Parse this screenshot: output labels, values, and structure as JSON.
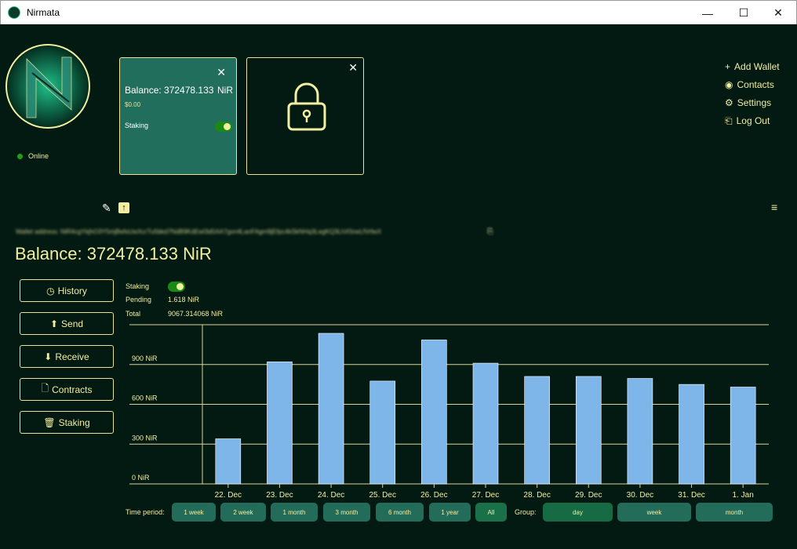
{
  "window": {
    "title": "Nirmata",
    "minimize": "—",
    "maximize": "☐",
    "close": "✕"
  },
  "status": {
    "label": "Online",
    "color": "#1ea01a"
  },
  "wallet_card": {
    "balance": "Balance: 372478.133",
    "unit": "NiR",
    "fiat": "$0.00",
    "staking_label": "Staking",
    "staking_on": true
  },
  "locked_card": {
    "icon": "lock-icon"
  },
  "menu": [
    {
      "icon": "plus-icon",
      "label": "Add Wallet"
    },
    {
      "icon": "user-circle-icon",
      "label": "Contacts"
    },
    {
      "icon": "gear-icon",
      "label": "Settings"
    },
    {
      "icon": "logout-icon",
      "label": "Log Out"
    }
  ],
  "wallet_address": {
    "label": "Wallet address:",
    "value": "NiR4cgYkjhO3Y5mjBefsUwXcrTu5bkd7NdB9KdEwl3d5AA7gvn4LanFAgm9jEfpc4kSkNHq3LegKQ3LhX5neLfVrfwX"
  },
  "balance": "Balance: 372478.133 NiR",
  "side_buttons": [
    {
      "icon": "clock-icon",
      "label": "History"
    },
    {
      "icon": "upload-icon",
      "label": "Send"
    },
    {
      "icon": "download-icon",
      "label": "Receive"
    },
    {
      "icon": "document-icon",
      "label": "Contracts"
    },
    {
      "icon": "bucket-icon",
      "label": "Staking"
    }
  ],
  "staking_info": {
    "staking_label": "Staking",
    "staking_on": true,
    "pending_label": "Pending",
    "pending_value": "1.618 NiR",
    "total_label": "Total",
    "total_value": "9067.314068 NiR"
  },
  "chart_data": {
    "type": "bar",
    "categories": [
      "22. Dec",
      "23. Dec",
      "24. Dec",
      "25. Dec",
      "26. Dec",
      "27. Dec",
      "28. Dec",
      "29. Dec",
      "30. Dec",
      "31. Dec",
      "1. Jan"
    ],
    "values": [
      340,
      920,
      1135,
      775,
      1085,
      910,
      810,
      810,
      795,
      750,
      730
    ],
    "yticks": [
      "0 NiR",
      "300 NiR",
      "600 NiR",
      "900 NiR"
    ],
    "ylim": [
      0,
      1200
    ],
    "grid": true,
    "bar_color": "#7fb6ea"
  },
  "controls": {
    "time_label": "Time period:",
    "time_options": [
      "1 week",
      "2 week",
      "1 month",
      "3 month",
      "6 month",
      "1 year",
      "All"
    ],
    "time_selected": "All",
    "group_label": "Group:",
    "group_options": [
      "day",
      "week",
      "month"
    ],
    "group_selected": "day"
  },
  "colors": {
    "background": "#021a12",
    "accent": "#f3eea0",
    "card": "#226e5c"
  }
}
